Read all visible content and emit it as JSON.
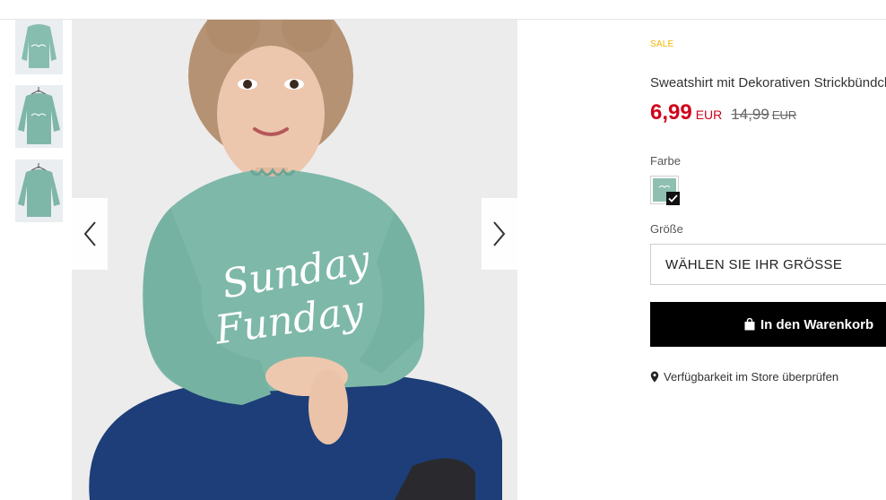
{
  "product": {
    "badge": "SALE",
    "title": "Sweatshirt mit Dekorativen Strickbündchen",
    "price": {
      "current": "6,99",
      "current_currency": "EUR",
      "old": "14,99",
      "old_currency": "EUR"
    },
    "color_label": "Farbe",
    "size_label": "Größe",
    "size_placeholder": "WÄHLEN SIE IHR GRÖSSE",
    "add_to_cart_label": "In den Warenkorb",
    "store_availability_label": "Verfügbarkeit im Store überprüfen"
  },
  "gallery": {
    "sweatshirt_print_line1": "Sunday",
    "sweatshirt_print_line2": "Funday",
    "thumbnails": [
      "thumbnail-front",
      "thumbnail-hanger",
      "thumbnail-back"
    ]
  },
  "colors": {
    "sale": "#f0b400",
    "price": "#d0021b",
    "sweatshirt": "#7eb8a8",
    "pants": "#1d3e78",
    "button": "#000000"
  }
}
